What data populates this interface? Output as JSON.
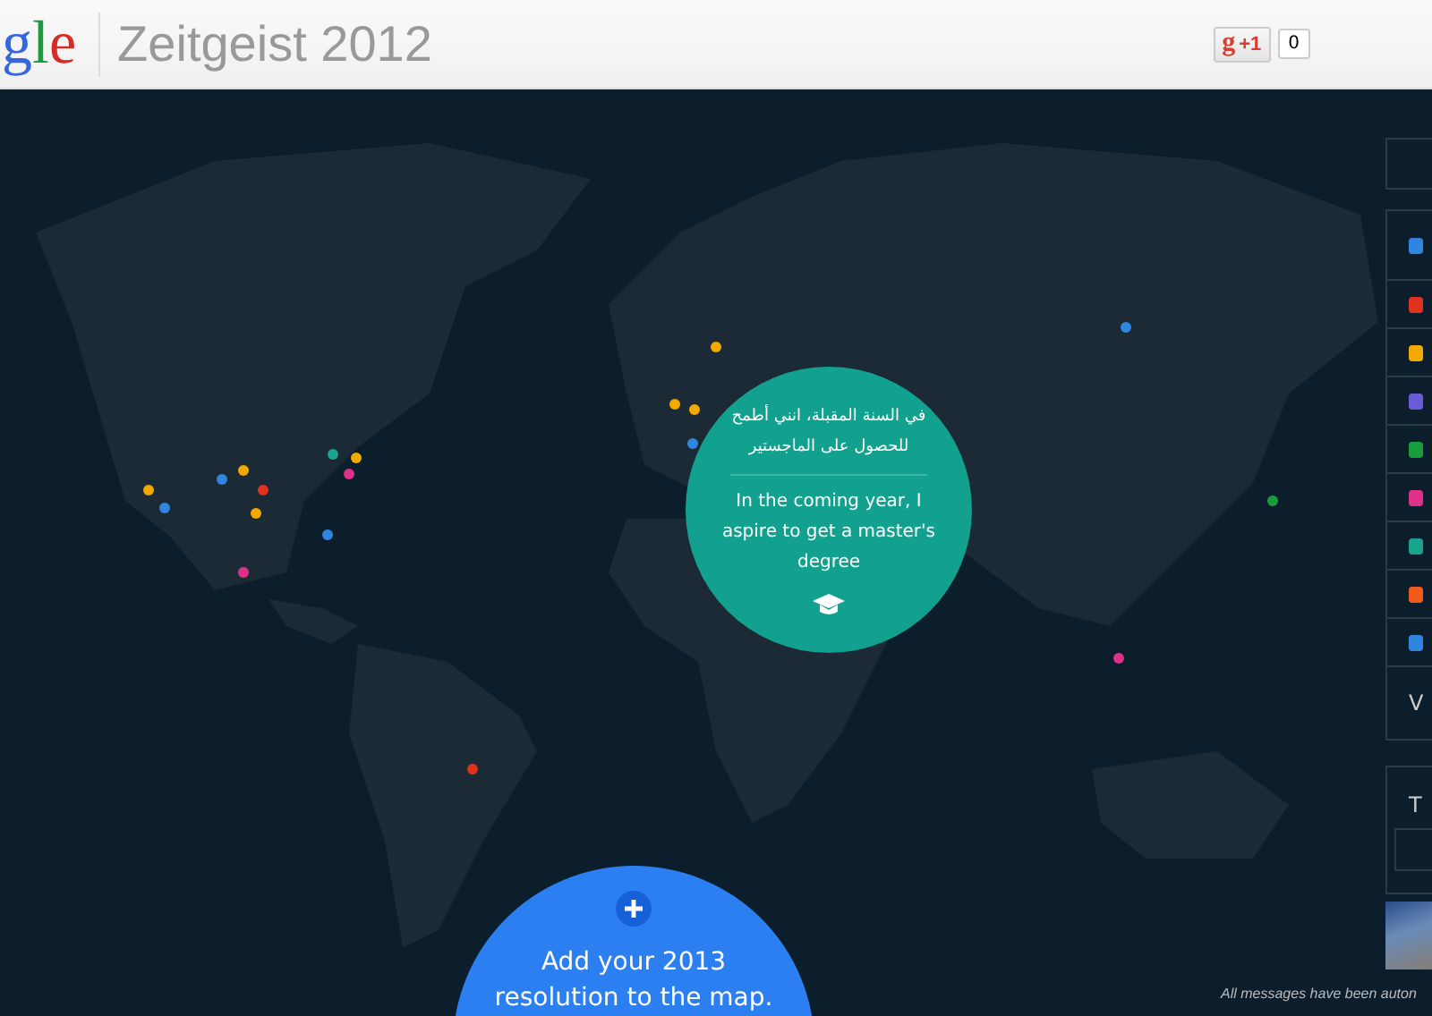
{
  "header": {
    "logo_letters": [
      {
        "char": "g",
        "color": "#3466e0"
      },
      {
        "char": "l",
        "color": "#1a9c3c"
      },
      {
        "char": "e",
        "color": "#d92b25"
      }
    ],
    "title": "Zeitgeist 2012",
    "plus_one": {
      "icon_letter": "g",
      "label": "+1",
      "count": "0"
    }
  },
  "map": {
    "pins": [
      {
        "color": "#f2a900"
      },
      {
        "color": "#2f86de"
      },
      {
        "color": "#f2a900"
      },
      {
        "color": "#f2a900"
      },
      {
        "color": "#2f86de"
      },
      {
        "color": "#1aa38f"
      },
      {
        "color": "#f2a900"
      },
      {
        "color": "#e0318a"
      },
      {
        "color": "#2f86de"
      },
      {
        "color": "#f2a900"
      },
      {
        "color": "#e0331f"
      },
      {
        "color": "#f2a900"
      },
      {
        "color": "#f2a900"
      },
      {
        "color": "#2f86de"
      },
      {
        "color": "#2f86de"
      },
      {
        "color": "#1a9c3c"
      },
      {
        "color": "#e0318a"
      },
      {
        "color": "#e0318a"
      },
      {
        "color": "#e0331f"
      }
    ],
    "message": {
      "original": "في السنة المقبلة، انني أطمح للحصول على الماجستير",
      "translation": "In the coming year, I aspire to get a master's degree"
    },
    "add_bubble": {
      "text": "Add your 2013 resolution to the map."
    },
    "footer_note": "All messages have been auton"
  },
  "side_panel": {
    "categories": [
      {
        "color": "#2f86de"
      },
      {
        "color": "#e0331f"
      },
      {
        "color": "#f2a900"
      },
      {
        "color": "#6a5bd6"
      },
      {
        "color": "#1a9c3c"
      },
      {
        "color": "#e0318a"
      },
      {
        "color": "#1aa38f"
      },
      {
        "color": "#f05a1a"
      },
      {
        "color": "#2f86de"
      }
    ],
    "view_label": "V",
    "second_box_label": "T"
  }
}
